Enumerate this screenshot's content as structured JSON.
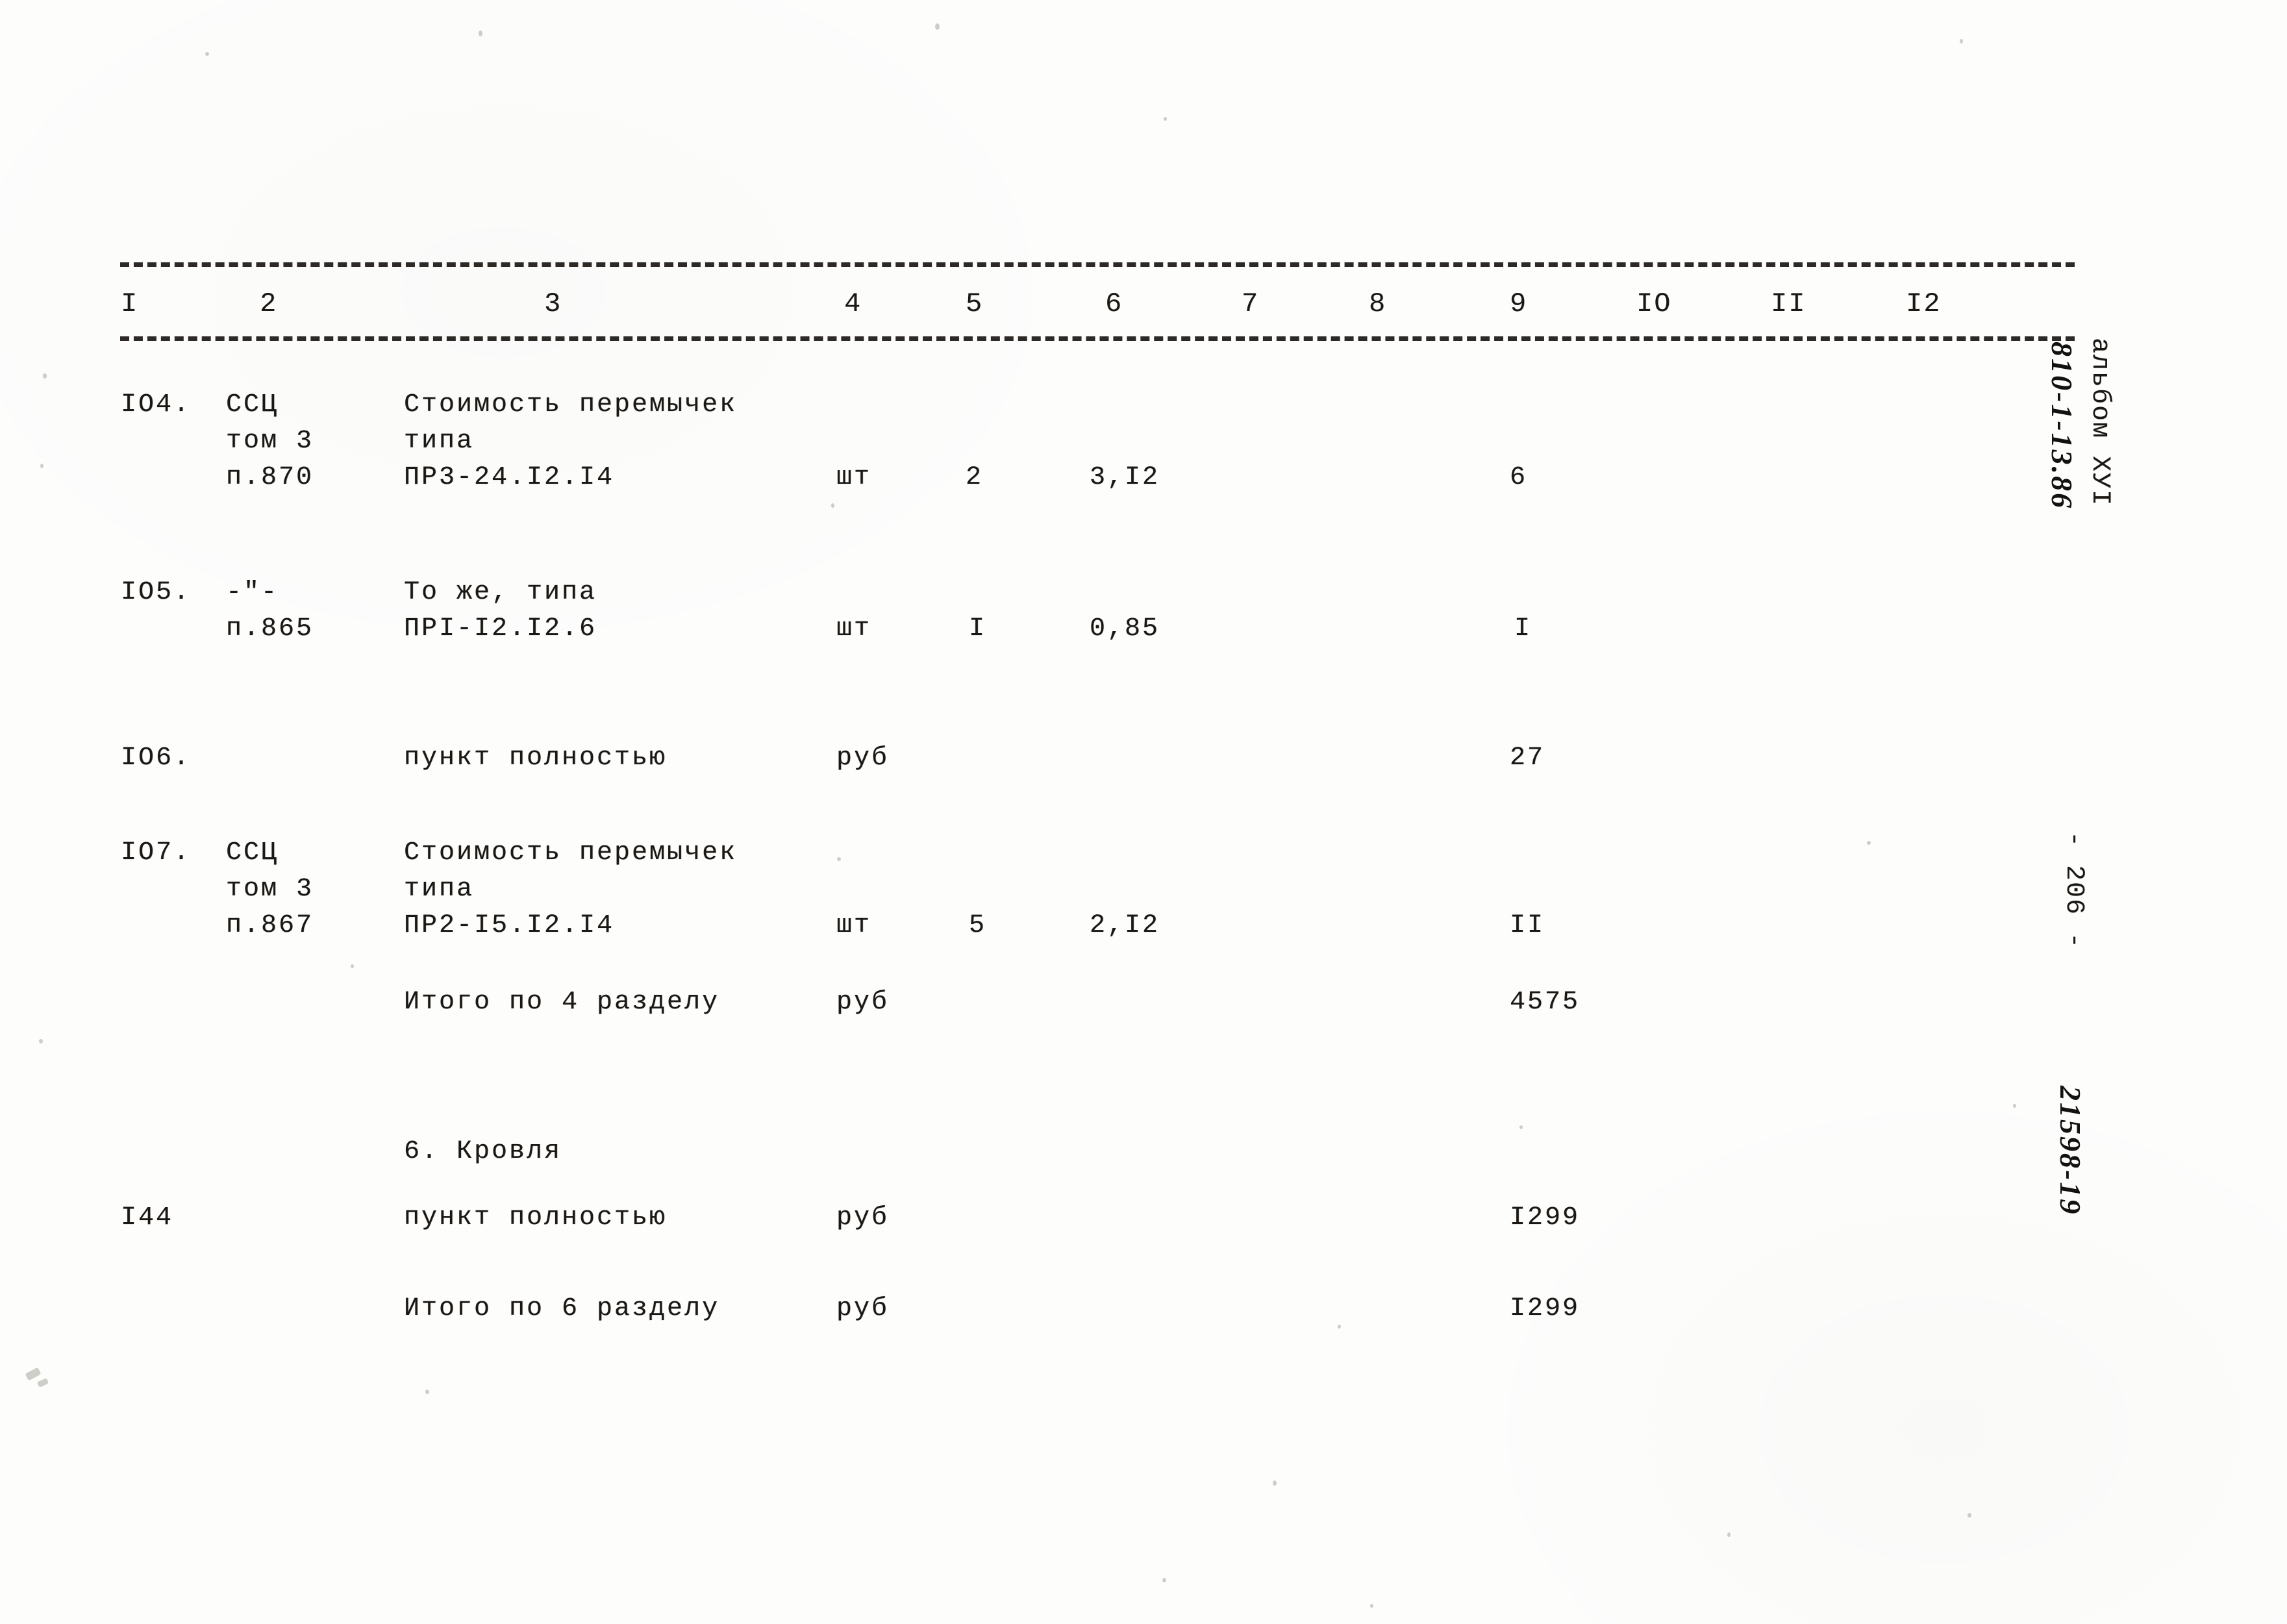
{
  "document": {
    "kind": "construction-cost-estimate-table",
    "language": "ru"
  },
  "table": {
    "column_headers": [
      "I",
      "2",
      "3",
      "4",
      "5",
      "6",
      "7",
      "8",
      "9",
      "IO",
      "II",
      "I2"
    ],
    "rows": [
      {
        "id": "row-104",
        "c1": "IO4.",
        "c2_lines": [
          "ССЦ",
          "том 3",
          "п.870"
        ],
        "c3_lines": [
          "Стоимость перемычек",
          "типа",
          "ПР3-24.I2.I4"
        ],
        "c4": "шт",
        "c5": "2",
        "c6": "3,I2",
        "c9": "6"
      },
      {
        "id": "row-105",
        "c1": "IO5.",
        "c2_lines": [
          "-\"-",
          "п.865"
        ],
        "c3_lines": [
          "То же, типа",
          "ПРI-I2.I2.6"
        ],
        "c4": "шт",
        "c5": "I",
        "c6": "0,85",
        "c9": "I"
      },
      {
        "id": "row-106",
        "c1": "IO6.",
        "c2_lines": [],
        "c3_lines": [
          "пункт полностью"
        ],
        "c4": "руб",
        "c5": "",
        "c6": "",
        "c9": "27"
      },
      {
        "id": "row-107",
        "c1": "IO7.",
        "c2_lines": [
          "ССЦ",
          "том 3",
          "п.867"
        ],
        "c3_lines": [
          "Стоимость перемычек",
          "типа",
          "ПР2-I5.I2.I4"
        ],
        "c4": "шт",
        "c5": "5",
        "c6": "2,I2",
        "c9": "II"
      },
      {
        "id": "row-total-4",
        "c1": "",
        "c2_lines": [],
        "c3_lines": [
          "Итого по 4 разделу"
        ],
        "c4": "руб",
        "c5": "",
        "c6": "",
        "c9": "4575"
      },
      {
        "id": "row-144",
        "c1": "I44",
        "c2_lines": [],
        "c3_lines": [
          "пункт полностью"
        ],
        "c4": "руб",
        "c5": "",
        "c6": "",
        "c9": "I299"
      },
      {
        "id": "row-total-6",
        "c1": "",
        "c2_lines": [],
        "c3_lines": [
          "Итого по 6 разделу"
        ],
        "c4": "руб",
        "c5": "",
        "c6": "",
        "c9": "I299"
      }
    ],
    "section_heading": "6. Кровля"
  },
  "margin_notes": {
    "album_typed": "альбом ХУI",
    "album_handwritten": "810-1-13.86",
    "page_number": "- 206 -",
    "archive_handwritten": "21598-19"
  }
}
